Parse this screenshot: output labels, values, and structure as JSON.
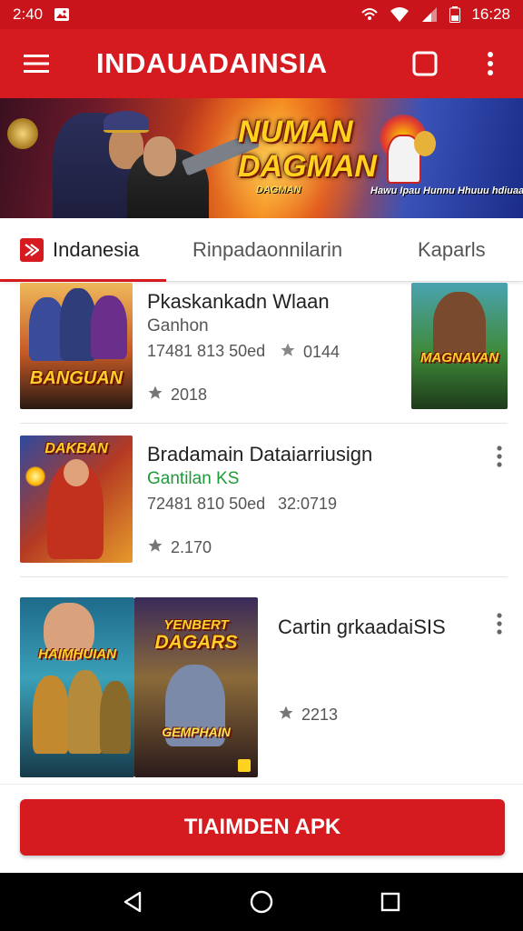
{
  "status_bar": {
    "time_left": "2:40",
    "time_right": "16:28"
  },
  "app_bar": {
    "title": "INDAUADAINSIA",
    "menu_icon": "hamburger-menu-icon",
    "cast_icon": "square-icon",
    "more_icon": "more-vert-icon"
  },
  "banner": {
    "title": "NUMAN DAGMAN",
    "subtitle": "DAGMAN",
    "tagline": "Hawu Ipau Hunnu Hhuuu hdiuaa!"
  },
  "tabs": [
    {
      "label": "Indanesia",
      "active": true,
      "icon": "app-logo-icon"
    },
    {
      "label": "Rinpadaonnilarin",
      "active": false
    },
    {
      "label": "Kaparls",
      "active": false
    }
  ],
  "items": [
    {
      "title": "Pkaskankadn Wlaan",
      "developer": "Ganhon",
      "meta_size": "17481 813 50ed",
      "meta_downloads": "0144",
      "rating": "2018",
      "thumb_label": "BANGUAN",
      "side_thumb_label": "MAGNAVAN"
    },
    {
      "title": "Bradamain Dataiarriusign",
      "developer": "Gantilan KS",
      "meta_size": "72481 810 50ed",
      "meta_downloads": "32:0719",
      "rating": "2.170",
      "thumb_label": "DAKBAN"
    },
    {
      "title": "Cartin grkaadaiSIS",
      "rating": "2213",
      "thumb_label": "HAIMHUIAN",
      "thumb2_label": "DAGARS",
      "thumb2_top": "YENBERT",
      "thumb2_bottom": "GEMPHAIN"
    }
  ],
  "install_button": {
    "label": "TIAIMDEN APK"
  },
  "colors": {
    "brand_red": "#d51b1f",
    "status_red": "#c8141a"
  }
}
